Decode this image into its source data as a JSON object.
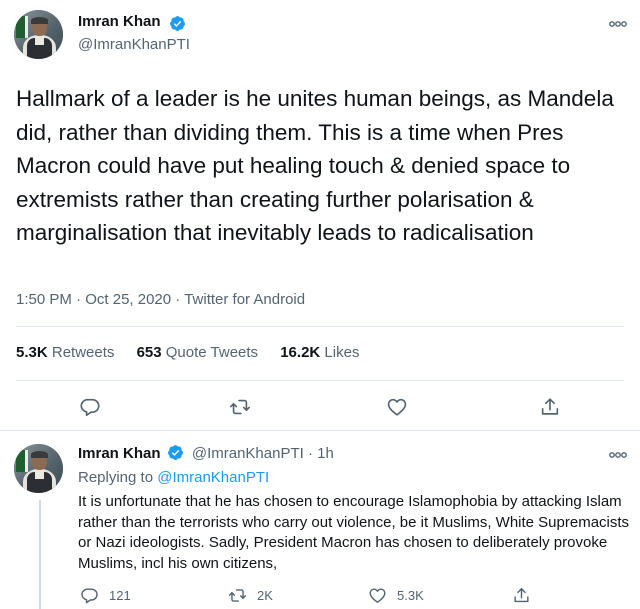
{
  "main_tweet": {
    "author_name": "Imran Khan",
    "author_handle": "@ImranKhanPTI",
    "text": "Hallmark of a leader is he unites human beings, as Mandela did, rather than dividing them. This is a time when Pres Macron could have put healing touch & denied space to extremists rather than creating further polarisation & marginalisation that inevitably leads to radicalisation",
    "time": "1:50 PM",
    "date": "Oct 25, 2020",
    "source": "Twitter for Android",
    "retweets_count": "5.3K",
    "retweets_label": "Retweets",
    "quotes_count": "653",
    "quotes_label": "Quote Tweets",
    "likes_count": "16.2K",
    "likes_label": "Likes"
  },
  "reply_tweet": {
    "author_name": "Imran Khan",
    "author_handle": "@ImranKhanPTI",
    "age": "1h",
    "replying_prefix": "Replying to",
    "replying_to": "@ImranKhanPTI",
    "text": "It is unfortunate that he has chosen to encourage Islamophobia by attacking Islam rather than the terrorists who carry out violence, be it Muslims, White Supremacists or Nazi ideologists. Sadly, President Macron has chosen to deliberately provoke Muslims, incl his own citizens,",
    "reply_count": "121",
    "retweet_count": "2K",
    "like_count": "5.3K"
  },
  "colors": {
    "verified": "#1d9bf0",
    "link": "#1d9bf0",
    "secondary_text": "#536471",
    "icon": "#536471"
  },
  "icons": [
    "verified-icon",
    "more-icon",
    "reply-icon",
    "retweet-icon",
    "like-icon",
    "share-icon"
  ]
}
